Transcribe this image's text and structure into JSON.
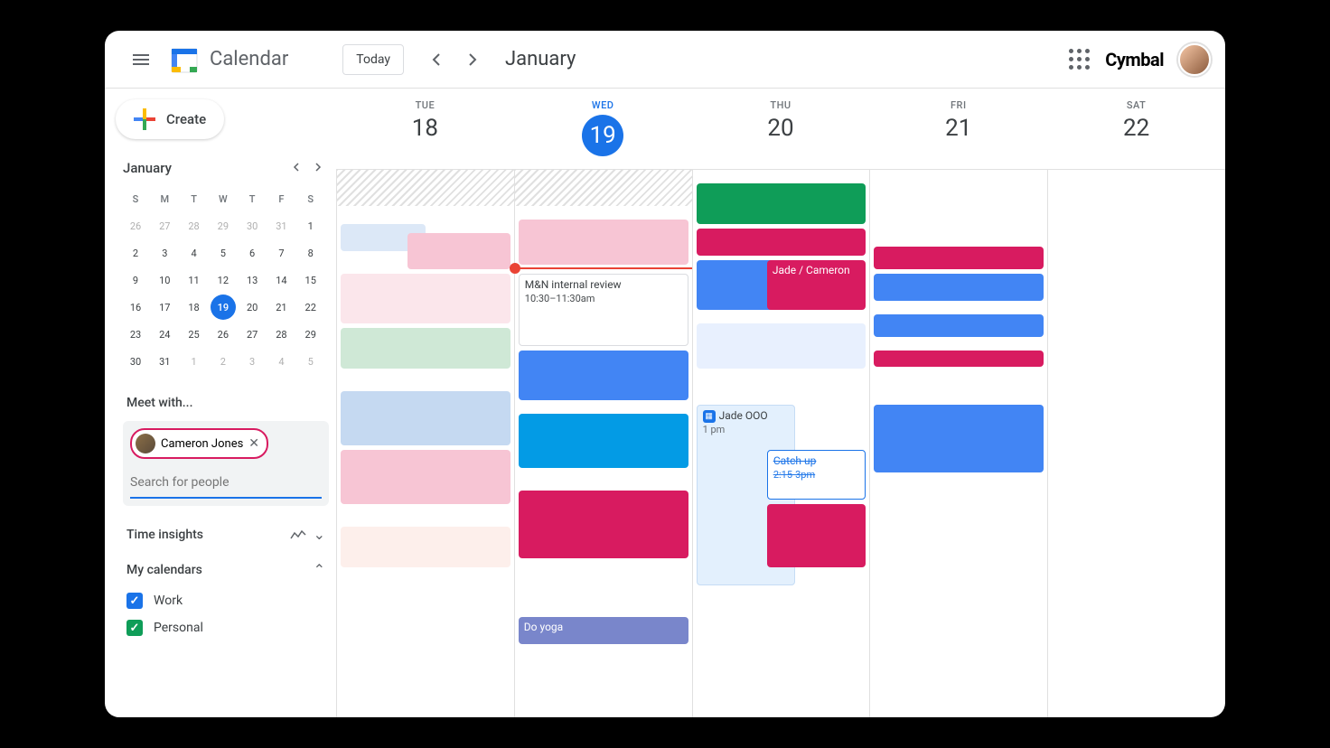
{
  "header": {
    "app_title": "Calendar",
    "logo_day": "19",
    "today_label": "Today",
    "month_title": "January",
    "brand": "Cymbal"
  },
  "sidebar": {
    "create_label": "Create",
    "mini_cal": {
      "month": "January",
      "dow": [
        "S",
        "M",
        "T",
        "W",
        "T",
        "F",
        "S"
      ],
      "weeks": [
        [
          {
            "d": "26",
            "f": true
          },
          {
            "d": "27",
            "f": true
          },
          {
            "d": "28",
            "f": true
          },
          {
            "d": "29",
            "f": true
          },
          {
            "d": "30",
            "f": true
          },
          {
            "d": "31",
            "f": true
          },
          {
            "d": "1"
          }
        ],
        [
          {
            "d": "2"
          },
          {
            "d": "3"
          },
          {
            "d": "4"
          },
          {
            "d": "5"
          },
          {
            "d": "6"
          },
          {
            "d": "7"
          },
          {
            "d": "8"
          }
        ],
        [
          {
            "d": "9"
          },
          {
            "d": "10"
          },
          {
            "d": "11"
          },
          {
            "d": "12"
          },
          {
            "d": "13"
          },
          {
            "d": "14"
          },
          {
            "d": "15"
          }
        ],
        [
          {
            "d": "16"
          },
          {
            "d": "17"
          },
          {
            "d": "18"
          },
          {
            "d": "19",
            "t": true
          },
          {
            "d": "20"
          },
          {
            "d": "21"
          },
          {
            "d": "22"
          }
        ],
        [
          {
            "d": "23"
          },
          {
            "d": "24"
          },
          {
            "d": "25"
          },
          {
            "d": "26"
          },
          {
            "d": "27"
          },
          {
            "d": "28"
          },
          {
            "d": "29"
          }
        ],
        [
          {
            "d": "30"
          },
          {
            "d": "31"
          },
          {
            "d": "1",
            "f": true
          },
          {
            "d": "2",
            "f": true
          },
          {
            "d": "3",
            "f": true
          },
          {
            "d": "4",
            "f": true
          },
          {
            "d": "5",
            "f": true
          }
        ]
      ]
    },
    "meet_with_label": "Meet with...",
    "meet_chip": "Cameron Jones",
    "search_placeholder": "Search for people",
    "time_insights_label": "Time insights",
    "my_calendars_label": "My calendars",
    "calendars": [
      {
        "label": "Work",
        "color": "blue"
      },
      {
        "label": "Personal",
        "color": "green"
      }
    ]
  },
  "days": [
    {
      "dow": "TUE",
      "num": "18"
    },
    {
      "dow": "WED",
      "num": "19",
      "active": true
    },
    {
      "dow": "THU",
      "num": "20"
    },
    {
      "dow": "FRI",
      "num": "21"
    },
    {
      "dow": "SAT",
      "num": "22"
    }
  ],
  "events": {
    "wed_review_title": "M&N internal review",
    "wed_review_time": "10:30–11:30am",
    "wed_yoga": "Do yoga",
    "thu_jade_cameron": "Jade / Cameron",
    "thu_ooo_title": "Jade OOO",
    "thu_ooo_time": "1 pm",
    "thu_catchup_title": "Catch up",
    "thu_catchup_time": "2:15-3pm"
  }
}
